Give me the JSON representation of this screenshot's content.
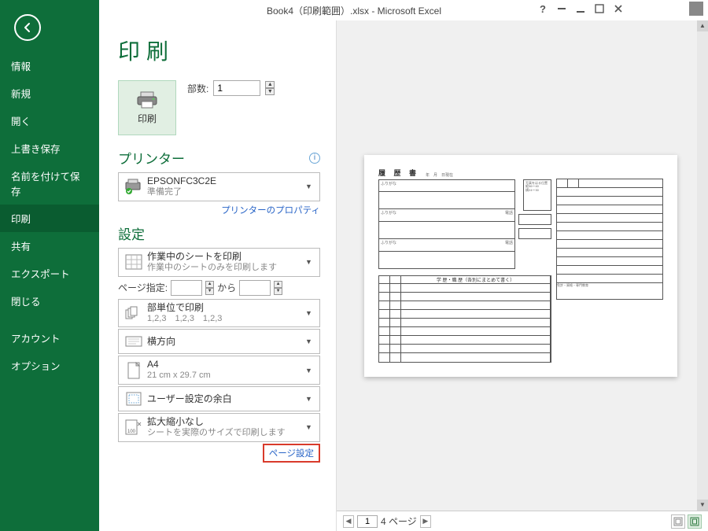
{
  "title": "Book4（印刷範囲）.xlsx - Microsoft Excel",
  "user_name": "　　　　　",
  "sidebar": {
    "items": [
      {
        "label": "情報"
      },
      {
        "label": "新規"
      },
      {
        "label": "開く"
      },
      {
        "label": "上書き保存"
      },
      {
        "label": "名前を付けて保存"
      },
      {
        "label": "印刷"
      },
      {
        "label": "共有"
      },
      {
        "label": "エクスポート"
      },
      {
        "label": "閉じる"
      }
    ],
    "footer": [
      {
        "label": "アカウント"
      },
      {
        "label": "オプション"
      }
    ]
  },
  "print": {
    "heading": "印刷",
    "button_label": "印刷",
    "copies_label": "部数:",
    "copies_value": "1",
    "printer_section": "プリンター",
    "printer_name": "EPSONFC3C2E",
    "printer_status": "準備完了",
    "printer_properties": "プリンターのプロパティ",
    "settings_section": "設定",
    "print_what_line1": "作業中のシートを印刷",
    "print_what_line2": "作業中のシートのみを印刷します",
    "pages_label": "ページ指定:",
    "pages_from": "",
    "pages_to_label": "から",
    "pages_to": "",
    "collate_line1": "部単位で印刷",
    "collate_line2": "1,2,3　1,2,3　1,2,3",
    "orientation": "横方向",
    "paper_line1": "A4",
    "paper_line2": "21 cm x 29.7 cm",
    "margins": "ユーザー設定の余白",
    "scale_line1": "拡大縮小なし",
    "scale_line2": "シートを実際のサイズで印刷します",
    "page_setup": "ページ設定"
  },
  "preview": {
    "doc_title": "履 歴 書",
    "table_header": "学 歴・職 歴（各別にまとめて書く）",
    "furigana": "ふりがな",
    "current_page": "1",
    "total_label": "4 ページ"
  }
}
